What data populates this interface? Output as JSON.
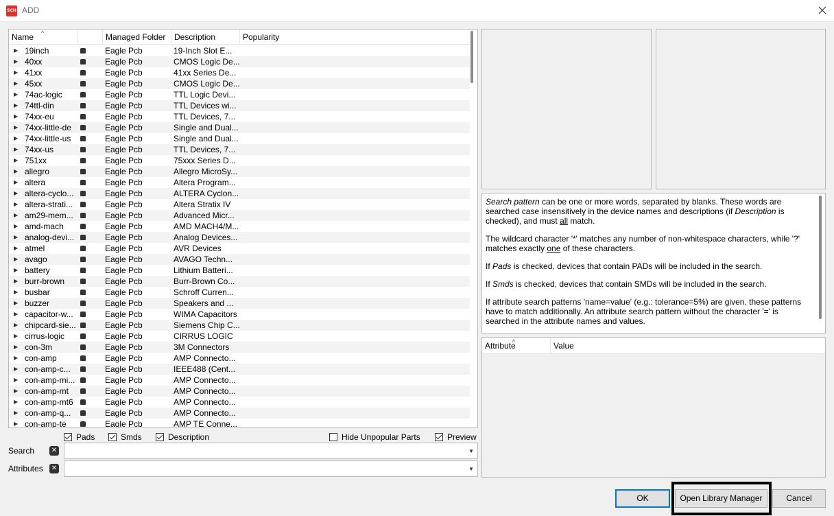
{
  "window": {
    "title": "ADD",
    "app_icon_text": "SCH"
  },
  "table": {
    "columns": [
      "Name",
      "",
      "Managed Folder",
      "Description",
      "Popularity"
    ],
    "rows": [
      [
        "19inch",
        "Eagle Pcb",
        "19-Inch Slot E..."
      ],
      [
        "40xx",
        "Eagle Pcb",
        "CMOS Logic De..."
      ],
      [
        "41xx",
        "Eagle Pcb",
        "41xx Series De..."
      ],
      [
        "45xx",
        "Eagle Pcb",
        "CMOS Logic De..."
      ],
      [
        "74ac-logic",
        "Eagle Pcb",
        "TTL Logic Devi..."
      ],
      [
        "74ttl-din",
        "Eagle Pcb",
        "TTL Devices wi..."
      ],
      [
        "74xx-eu",
        "Eagle Pcb",
        "TTL Devices, 7..."
      ],
      [
        "74xx-little-de",
        "Eagle Pcb",
        "Single and Dual..."
      ],
      [
        "74xx-little-us",
        "Eagle Pcb",
        "Single and Dual..."
      ],
      [
        "74xx-us",
        "Eagle Pcb",
        "TTL Devices, 7..."
      ],
      [
        "751xx",
        "Eagle Pcb",
        "75xxx Series D..."
      ],
      [
        "allegro",
        "Eagle Pcb",
        "Allegro MicroSy..."
      ],
      [
        "altera",
        "Eagle Pcb",
        "Altera Program..."
      ],
      [
        "altera-cyclo...",
        "Eagle Pcb",
        "ALTERA Cyclon..."
      ],
      [
        "altera-strati...",
        "Eagle Pcb",
        "Altera Stratix IV"
      ],
      [
        "am29-mem...",
        "Eagle Pcb",
        "Advanced Micr..."
      ],
      [
        "amd-mach",
        "Eagle Pcb",
        "AMD MACH4/M..."
      ],
      [
        "analog-devi...",
        "Eagle Pcb",
        "Analog Devices..."
      ],
      [
        "atmel",
        "Eagle Pcb",
        "AVR Devices"
      ],
      [
        "avago",
        "Eagle Pcb",
        "AVAGO Techn..."
      ],
      [
        "battery",
        "Eagle Pcb",
        "Lithium Batteri..."
      ],
      [
        "burr-brown",
        "Eagle Pcb",
        "Burr-Brown Co..."
      ],
      [
        "busbar",
        "Eagle Pcb",
        "Schroff Curren..."
      ],
      [
        "buzzer",
        "Eagle Pcb",
        "Speakers and ..."
      ],
      [
        "capacitor-w...",
        "Eagle Pcb",
        "WIMA Capacitors"
      ],
      [
        "chipcard-sie...",
        "Eagle Pcb",
        "Siemens Chip C..."
      ],
      [
        "cirrus-logic",
        "Eagle Pcb",
        "CIRRUS LOGIC"
      ],
      [
        "con-3m",
        "Eagle Pcb",
        "3M Connectors"
      ],
      [
        "con-amp",
        "Eagle Pcb",
        "AMP Connecto..."
      ],
      [
        "con-amp-c...",
        "Eagle Pcb",
        "IEEE488 (Cent..."
      ],
      [
        "con-amp-mi...",
        "Eagle Pcb",
        "AMP Connecto..."
      ],
      [
        "con-amp-mt",
        "Eagle Pcb",
        "AMP Connecto..."
      ],
      [
        "con-amp-mt6",
        "Eagle Pcb",
        "AMP Connecto..."
      ],
      [
        "con-amp-q...",
        "Eagle Pcb",
        "AMP Connecto..."
      ],
      [
        "con-amp-te",
        "Eagle Pcb",
        "AMP TE Conne..."
      ]
    ]
  },
  "options": {
    "pads": {
      "label": "Pads",
      "checked": true
    },
    "smds": {
      "label": "Smds",
      "checked": true
    },
    "description": {
      "label": "Description",
      "checked": true
    },
    "hide_unpopular": {
      "label": "Hide Unpopular Parts",
      "checked": false
    },
    "preview": {
      "label": "Preview",
      "checked": true
    }
  },
  "search": {
    "label": "Search",
    "value": ""
  },
  "attributes": {
    "label": "Attributes",
    "value": ""
  },
  "attr_table": {
    "columns": [
      "Attribute",
      "Value"
    ]
  },
  "buttons": {
    "ok": "OK",
    "open_library_manager": "Open Library Manager",
    "cancel": "Cancel"
  }
}
